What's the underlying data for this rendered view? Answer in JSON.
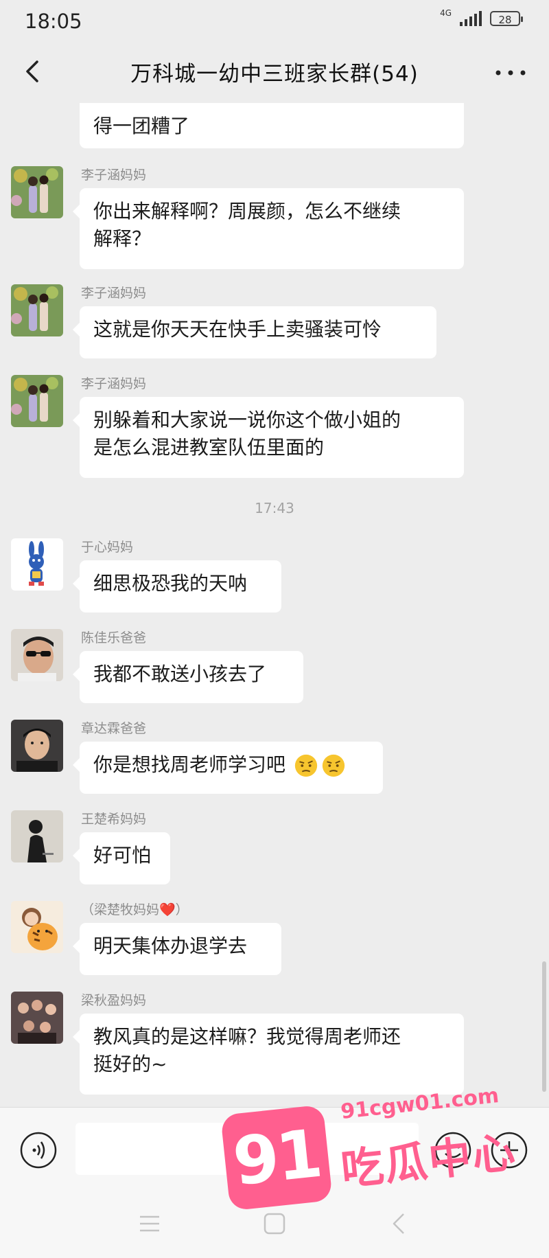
{
  "status_bar": {
    "time": "18:05",
    "network": "4G",
    "battery": "28"
  },
  "header": {
    "title": "万科城一幼中三班家长群(54)"
  },
  "messages": [
    {
      "sender": "",
      "text": "得一团糟了",
      "avatar": "none"
    },
    {
      "sender": "李子涵妈妈",
      "text": "你出来解释啊？周展颜，怎么不继续解释？",
      "avatar": "couple-photo"
    },
    {
      "sender": "李子涵妈妈",
      "text": "这就是你天天在快手上卖骚装可怜",
      "avatar": "couple-photo"
    },
    {
      "sender": "李子涵妈妈",
      "text": "别躲着和大家说一说你这个做小姐的是怎么混进教室队伍里面的",
      "avatar": "couple-photo"
    },
    {
      "sender": "于心妈妈",
      "text": "细思极恐我的天呐",
      "avatar": "blue-rabbit"
    },
    {
      "sender": "陈佳乐爸爸",
      "text": "我都不敢送小孩去了",
      "avatar": "man-sunglasses"
    },
    {
      "sender": "章达霖爸爸",
      "text": "你是想找周老师学习吧",
      "avatar": "man-portrait"
    },
    {
      "sender": "王楚希妈妈",
      "text": "好可怕",
      "avatar": "woman-silhouette"
    },
    {
      "sender": "（梁楚牧妈妈❤️）",
      "text": "明天集体办退学去",
      "avatar": "cartoon-tiger-girl"
    },
    {
      "sender": "梁秋盈妈妈",
      "text": "教风真的是这样嘛？我觉得周老师还挺好的~",
      "avatar": "group-photo"
    }
  ],
  "timestamp": "17:43",
  "message_lines": {
    "m1": [
      "你出来解释啊？周展颜，怎么不继续",
      "解释？"
    ],
    "m3": [
      "别躲着和大家说一说你这个做小姐的",
      "是怎么混进教室队伍里面的"
    ],
    "m9": [
      "教风真的是这样嘛？我觉得周老师还",
      "挺好的~"
    ]
  },
  "icons": {
    "back": "chevron-left-icon",
    "more": "more-dots-icon",
    "voice": "voice-icon",
    "emoji": "emoji-icon",
    "plus": "plus-icon",
    "confused_emoji": "thinking-face-emoji"
  },
  "input": {
    "value": ""
  },
  "watermark": {
    "number": "91",
    "url": "91cgw01.com",
    "name": "吃瓜中心"
  },
  "colors": {
    "background": "#ededed",
    "bubble": "#ffffff",
    "sender": "#8d8d8d",
    "watermark": "#ff5f8f"
  }
}
